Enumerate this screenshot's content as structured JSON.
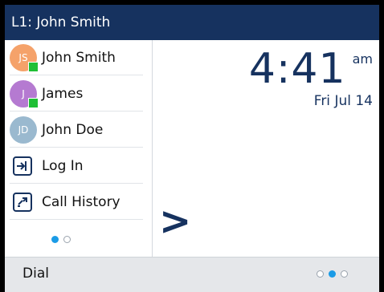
{
  "header": {
    "title": "L1: John Smith"
  },
  "sidebar": {
    "items": [
      {
        "type": "contact",
        "initials": "JS",
        "label": "John Smith",
        "avatar_color": "#f5a26a",
        "presence": true
      },
      {
        "type": "contact",
        "initials": "J",
        "label": "James",
        "avatar_color": "#b57ad1",
        "presence": true
      },
      {
        "type": "contact",
        "initials": "JD",
        "label": "John Doe",
        "avatar_color": "#9ab9cf",
        "presence": false
      },
      {
        "type": "action",
        "icon": "login-icon",
        "label": "Log In"
      },
      {
        "type": "action",
        "icon": "call-history-icon",
        "label": "Call History"
      }
    ],
    "page_dots": {
      "count": 2,
      "active": 0
    }
  },
  "clock": {
    "time": "4:41",
    "ampm": "am",
    "date": "Fri Jul 14"
  },
  "next_arrow": ">",
  "softkeys": {
    "dial_label": "Dial",
    "page_dots": {
      "count": 3,
      "active": 1
    }
  },
  "colors": {
    "title_bar": "#16325f",
    "accent_blue": "#1a9be6",
    "presence_green": "#1fbf35",
    "softkey_bar": "#e5e7ea"
  }
}
